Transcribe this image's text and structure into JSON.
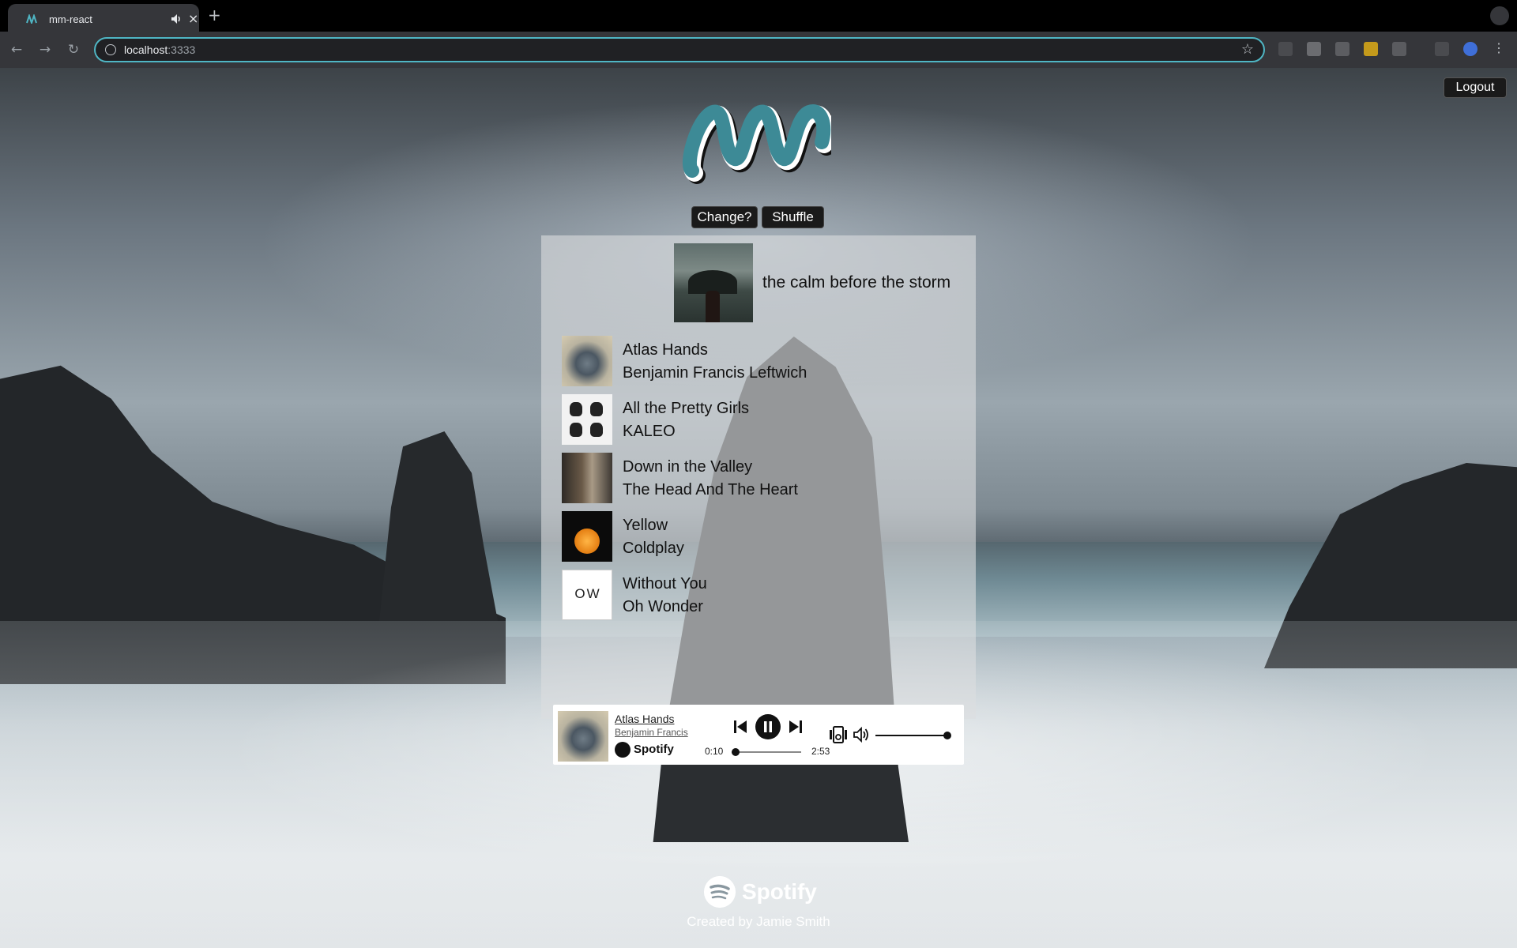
{
  "browser": {
    "tab_title": "mm-react",
    "url_host": "localhost",
    "url_port": ":3333"
  },
  "page": {
    "logout_label": "Logout",
    "change_label": "Change?",
    "shuffle_label": "Shuffle",
    "playlist": {
      "title": "the calm before the storm",
      "tracks": [
        {
          "title": "Atlas Hands",
          "artist": "Benjamin Francis Leftwich"
        },
        {
          "title": "All the Pretty Girls",
          "artist": "KALEO"
        },
        {
          "title": "Down in the Valley",
          "artist": "The Head And The Heart"
        },
        {
          "title": "Yellow",
          "artist": "Coldplay"
        },
        {
          "title": "Without You",
          "artist": "Oh Wonder"
        }
      ]
    },
    "ow_art_text": "OW",
    "player": {
      "track": "Atlas Hands",
      "artist": "Benjamin Francis",
      "brand": "Spotify",
      "elapsed": "0:10",
      "duration": "2:53",
      "progress_fraction": 0.058,
      "volume_fraction": 1.0
    },
    "footer": {
      "brand": "Spotify",
      "credit": "Created by Jamie Smith"
    }
  },
  "colors": {
    "logo_teal": "#3d8a96",
    "focus_ring": "#4fb6c4"
  },
  "icons": [
    "info-icon",
    "star-icon",
    "back-icon",
    "forward-icon",
    "reload-icon",
    "previous-icon",
    "pause-icon",
    "next-icon",
    "device-icon",
    "volume-icon",
    "spotify-logo-icon"
  ]
}
